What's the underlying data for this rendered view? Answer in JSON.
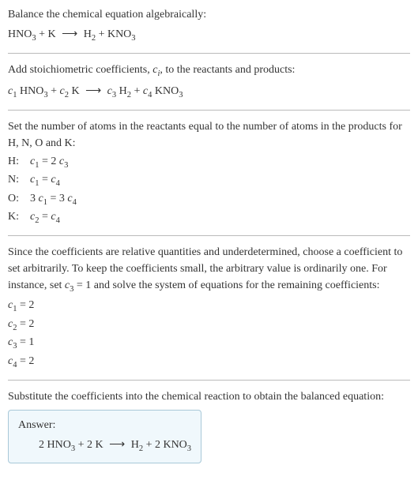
{
  "intro": {
    "line1": "Balance the chemical equation algebraically:",
    "eq_lhs1": "HNO",
    "eq_lhs1_sub": "3",
    "eq_plus1": " + K ",
    "eq_arrow": "⟶",
    "eq_rhs1": " H",
    "eq_rhs1_sub": "2",
    "eq_plus2": " + KNO",
    "eq_rhs2_sub": "3"
  },
  "step1": {
    "text_a": "Add stoichiometric coefficients, ",
    "ci": "c",
    "ci_sub": "i",
    "text_b": ", to the reactants and products:",
    "c1": "c",
    "c1_sub": "1",
    "hno3": " HNO",
    "hno3_sub": "3",
    "plus1": " + ",
    "c2": "c",
    "c2_sub": "2",
    "k": " K ",
    "arrow": "⟶",
    "sp": " ",
    "c3": "c",
    "c3_sub": "3",
    "h2": " H",
    "h2_sub": "2",
    "plus2": " + ",
    "c4": "c",
    "c4_sub": "4",
    "kno3": " KNO",
    "kno3_sub": "3"
  },
  "step2": {
    "intro": "Set the number of atoms in the reactants equal to the number of atoms in the products for H, N, O and K:",
    "rows": {
      "h_label": "H:",
      "h_c1": "c",
      "h_c1s": "1",
      "h_eq": " = 2 ",
      "h_c3": "c",
      "h_c3s": "3",
      "n_label": "N:",
      "n_c1": "c",
      "n_c1s": "1",
      "n_eq": " = ",
      "n_c4": "c",
      "n_c4s": "4",
      "o_label": "O:",
      "o_pre": "3 ",
      "o_c1": "c",
      "o_c1s": "1",
      "o_eq": " = 3 ",
      "o_c4": "c",
      "o_c4s": "4",
      "k_label": "K:",
      "k_c2": "c",
      "k_c2s": "2",
      "k_eq": " = ",
      "k_c4": "c",
      "k_c4s": "4"
    }
  },
  "step3": {
    "para_a": "Since the coefficients are relative quantities and underdetermined, choose a coefficient to set arbitrarily. To keep the coefficients small, the arbitrary value is ordinarily one. For instance, set ",
    "c3": "c",
    "c3_sub": "3",
    "para_b": " = 1 and solve the system of equations for the remaining coefficients:",
    "l1a": "c",
    "l1s": "1",
    "l1b": " = 2",
    "l2a": "c",
    "l2s": "2",
    "l2b": " = 2",
    "l3a": "c",
    "l3s": "3",
    "l3b": " = 1",
    "l4a": "c",
    "l4s": "4",
    "l4b": " = 2"
  },
  "step4": {
    "text": "Substitute the coefficients into the chemical reaction to obtain the balanced equation:"
  },
  "answer": {
    "label": "Answer:",
    "pre": "2 HNO",
    "sub1": "3",
    "mid1": " + 2 K ",
    "arrow": "⟶",
    "mid2": " H",
    "sub2": "2",
    "mid3": " + 2 KNO",
    "sub3": "3"
  }
}
